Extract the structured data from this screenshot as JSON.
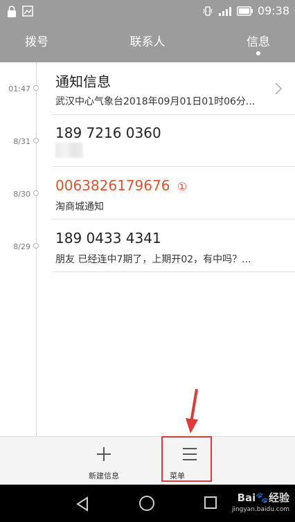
{
  "status_bar": {
    "time": "09:38",
    "left_icons": [
      "lock-icon",
      "image-icon"
    ],
    "right_icons": [
      "vibrate-icon",
      "signal-icon",
      "battery-icon"
    ]
  },
  "tabs": [
    {
      "label": "拨号",
      "active": false
    },
    {
      "label": "联系人",
      "active": false
    },
    {
      "label": "信息",
      "active": true
    }
  ],
  "messages": [
    {
      "date": "01:47",
      "title": "通知信息",
      "preview": "武汉中心气象台2018年09月01日01时06分..."
    },
    {
      "date": "8/31",
      "title": "189 7216 0360",
      "preview": ""
    },
    {
      "date": "8/30",
      "title": "0063826179676",
      "title_badge": "①",
      "title_color": "#e0532b",
      "preview": "淘商城通知"
    },
    {
      "date": "8/29",
      "title": "189 0433 4341",
      "preview": "朋友  已经连中7期了，上期开02，有中吗？..."
    }
  ],
  "toolbar": {
    "new_message_label": "新建信息",
    "menu_label": "菜单"
  },
  "watermark": {
    "brand": "Bai",
    "brand_suffix": "经验",
    "url": "jingyan.baidu.com"
  },
  "colors": {
    "header_bg": "#9c9c9c",
    "accent_red": "#e0532b",
    "highlight_red": "#e03a3a"
  }
}
